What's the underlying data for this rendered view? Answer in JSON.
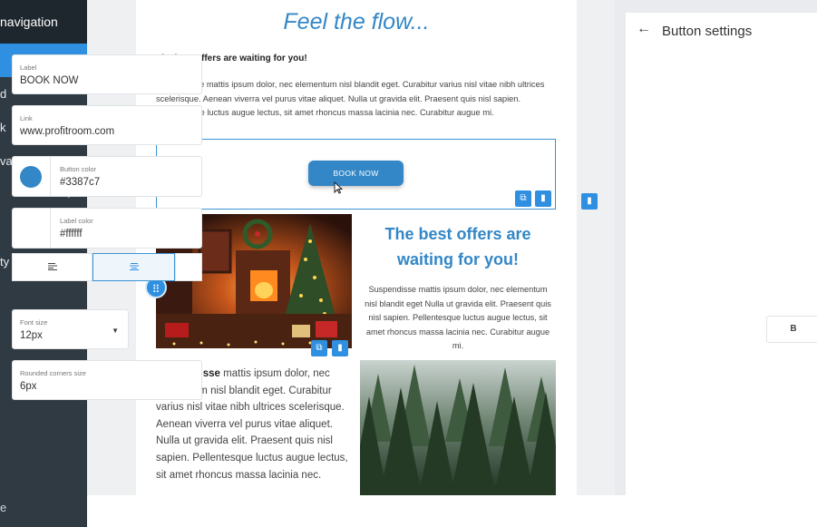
{
  "nav": {
    "header": "navigation",
    "items": [
      {
        "label": "",
        "active": true,
        "chevron": false
      },
      {
        "label": "d",
        "active": false,
        "chevron": false
      },
      {
        "label": "k",
        "active": false,
        "chevron": true
      },
      {
        "label": "vailability",
        "active": false,
        "chevron": true
      },
      {
        "label": "",
        "active": false,
        "chevron": true
      },
      {
        "label": "",
        "active": false,
        "chevron": true
      },
      {
        "label": "ty",
        "active": false,
        "chevron": false
      }
    ],
    "footer": "e"
  },
  "email": {
    "title": "Feel the flow...",
    "subtitle": "The best offers are waiting for you!",
    "paragraph": "Suspendisse mattis ipsum dolor, nec elementum nisl blandit eget. Curabitur varius nisl vitae nibh ultrices scelerisque. Aenean viverra vel purus vitae aliquet. Nulla ut gravida elit. Praesent quis nisl sapien. Pellentesque luctus augue lectus, sit amet rhoncus massa lacinia nec. Curabitur augue mi.",
    "button_label": "BOOK NOW",
    "col_title": "The best offers are waiting for you!",
    "col_paragraph": "Suspendisse mattis ipsum dolor, nec elementum nisl blandit eget Nulla ut gravida elit. Praesent quis nisl sapien. Pellentesque luctus augue lectus, sit amet rhoncus massa lacinia nec. Curabitur augue mi.",
    "left_bold": "Suspendisse",
    "left_paragraph": " mattis ipsum dolor, nec elementum nisl blandit eget. Curabitur varius nisl vitae nibh ultrices scelerisque. Aenean viverra vel purus vitae aliquet. Nulla ut gravida elit. Praesent quis nisl sapien. Pellentesque luctus augue lectus, sit amet rhoncus massa lacinia nec."
  },
  "panel": {
    "title": "Button settings",
    "label_caption": "Label",
    "label_value": "BOOK NOW",
    "link_caption": "Link",
    "link_value": "www.profitroom.com",
    "button_color_caption": "Button color",
    "button_color_value": "#3387c7",
    "label_color_caption": "Label color",
    "label_color_value": "#ffffff",
    "font_size_caption": "Font size",
    "font_size_value": "12px",
    "bold_label": "B",
    "rounded_caption": "Rounded corners size",
    "rounded_value": "6px",
    "alignment_selected": "center"
  },
  "colors": {
    "accent": "#3387c7",
    "nav_bg": "#2f3a43",
    "nav_active": "#2f8fe0"
  },
  "icons": [
    "drag-icon",
    "copy-icon",
    "delete-icon",
    "back-arrow-icon",
    "align-left-icon",
    "align-center-icon",
    "dropdown-caret-icon",
    "chevron-right-icon",
    "mouse-cursor-icon"
  ]
}
